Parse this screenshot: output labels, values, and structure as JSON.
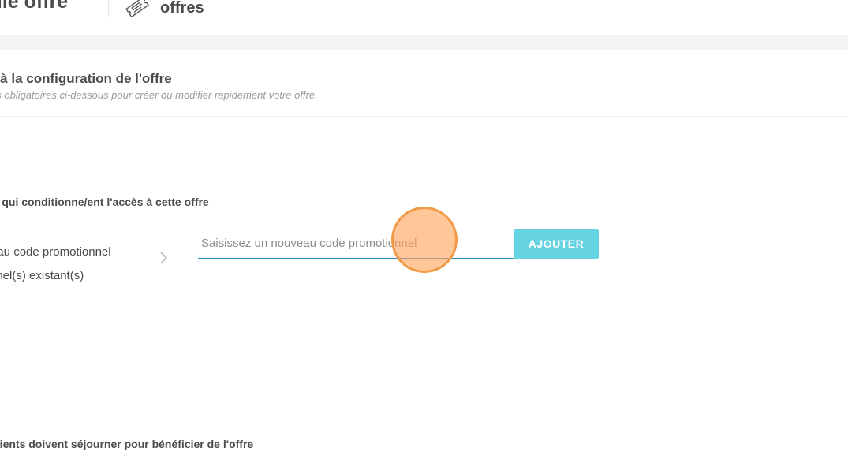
{
  "header": {
    "title": "elle offre",
    "section_label": "offres",
    "section_icon": "ticket-icon"
  },
  "config": {
    "title": "s à la configuration de l'offre",
    "subtitle": "ps obligatoires ci-dessous pour créer ou modifier rapidement votre offre."
  },
  "promo": {
    "heading": "s) qui conditionne/ent l'accès à cette offre",
    "options": [
      {
        "label": "eau code promotionnel"
      },
      {
        "label": "nnel(s) existant(s)"
      }
    ],
    "input": {
      "value": "",
      "placeholder": "Saisissez un nouveau code promotionnel"
    },
    "add_label": "AJOUTER"
  },
  "stay": {
    "heading": "clients doivent séjourner pour bénéficier de l'offre"
  },
  "colors": {
    "accent": "#66d3e3",
    "input_underline": "#2a8fbf",
    "click_marker": "#f09a46"
  }
}
